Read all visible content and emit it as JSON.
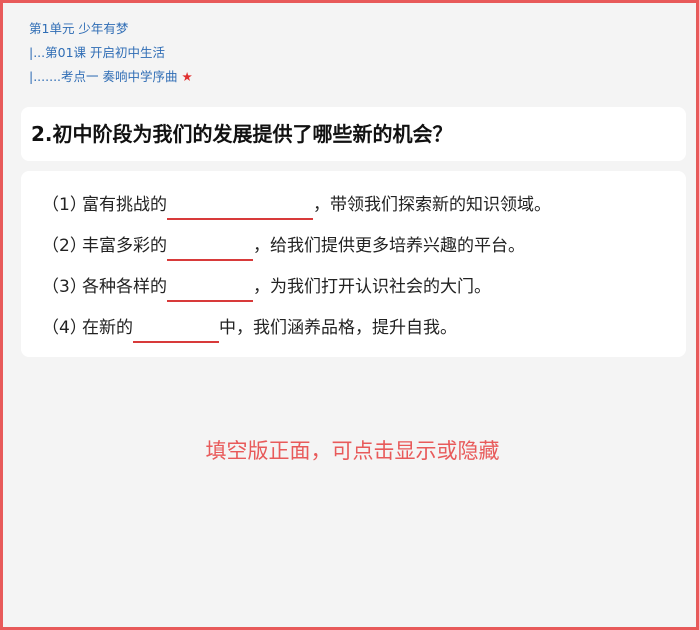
{
  "breadcrumb": {
    "unit": "第1单元 少年有梦",
    "lesson": "|...第01课 开启初中生活",
    "point": "|.......考点一 奏响中学序曲",
    "star": "★"
  },
  "question": {
    "title": "2.初中阶段为我们的发展提供了哪些新的机会？"
  },
  "answers": [
    {
      "num": "（1）",
      "before": "富有挑战的",
      "after": "，带领我们探索新的知识领域。"
    },
    {
      "num": "（2）",
      "before": "丰富多彩的",
      "after": "，给我们提供更多培养兴趣的平台。"
    },
    {
      "num": "（3）",
      "before": "各种各样的",
      "after": "，为我们打开认识社会的大门。"
    },
    {
      "num": "（4）",
      "before": "在新的",
      "after": "中，我们涵养品格，提升自我。"
    }
  ],
  "toggle_hint": "填空版正面，可点击显示或隐藏",
  "colors": {
    "frame_border": "#e85a5a",
    "breadcrumb_text": "#2f6db5",
    "star": "#e03030",
    "blank_underline": "#d83a3a",
    "hint_text": "#e85a5a"
  }
}
